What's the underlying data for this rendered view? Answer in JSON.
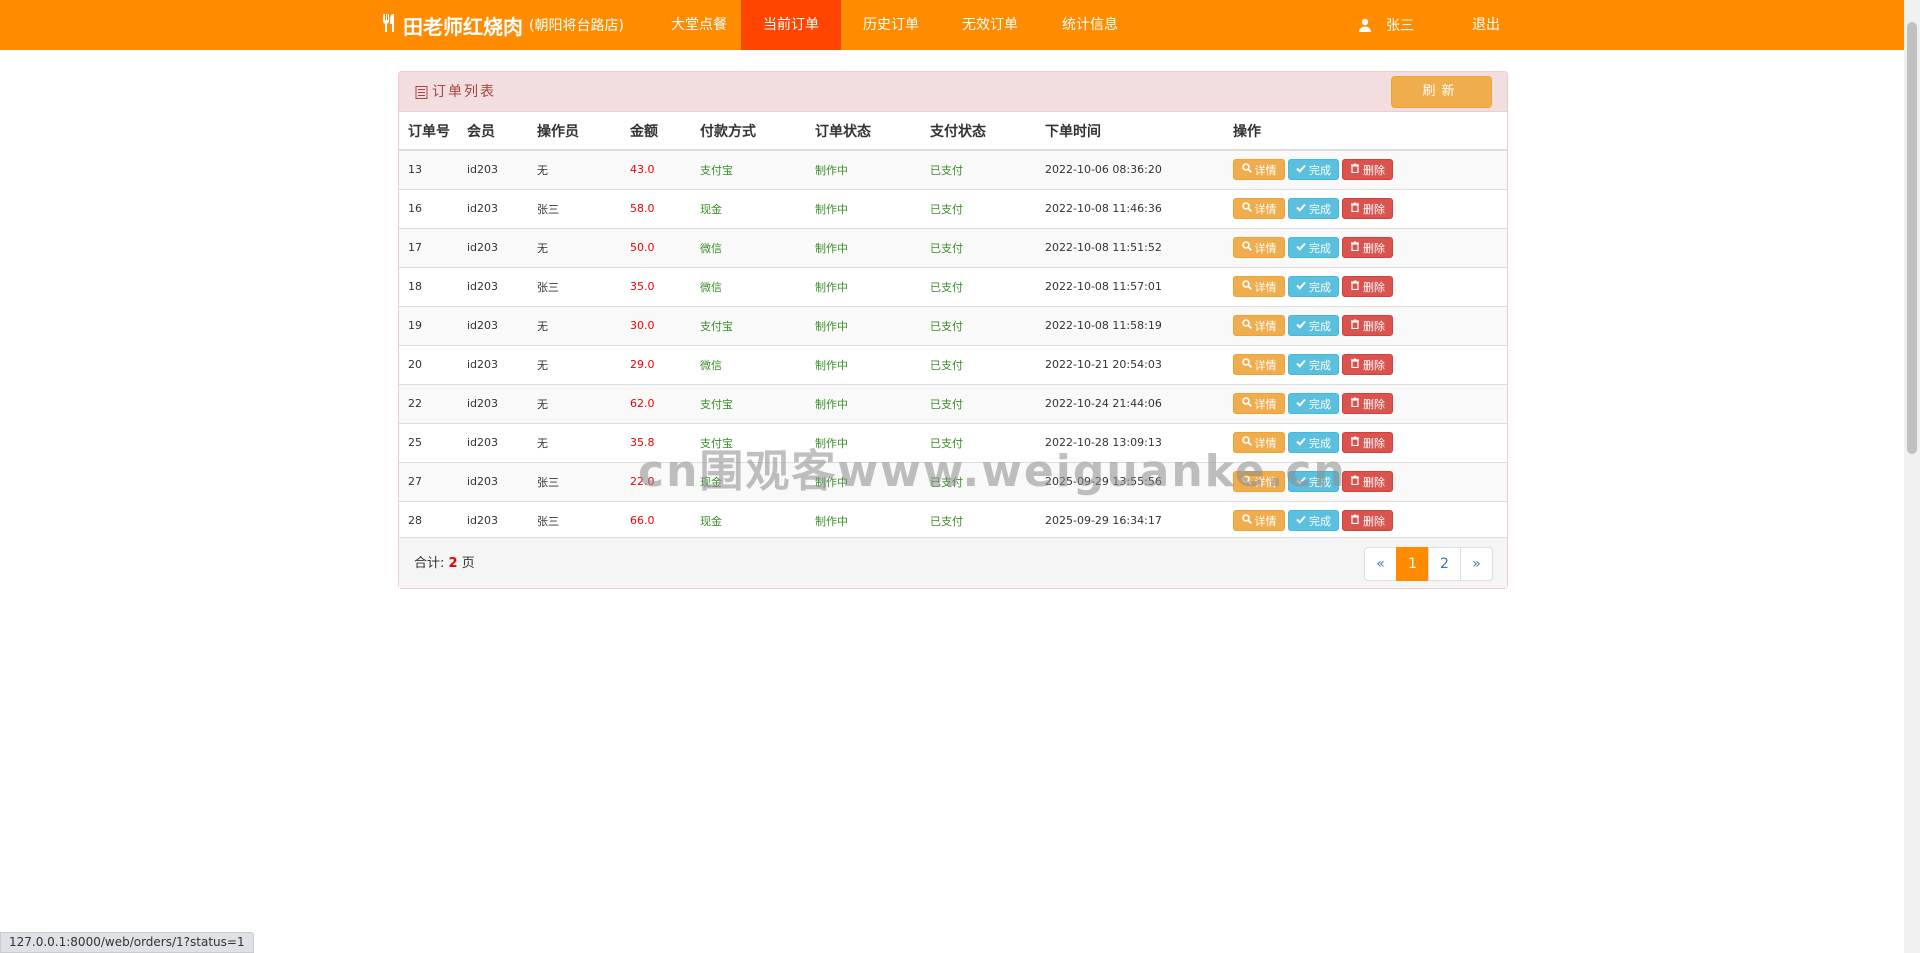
{
  "navbar": {
    "brand_name": "田老师红烧肉",
    "brand_sub": "(朝阳将台路店)",
    "items": [
      {
        "label": "大堂点餐"
      },
      {
        "label": "当前订单"
      },
      {
        "label": "历史订单"
      },
      {
        "label": "无效订单"
      },
      {
        "label": "统计信息"
      }
    ],
    "active_item": "当前订单",
    "user_name": "张三",
    "logout_label": "退出"
  },
  "panel": {
    "title": "订单列表",
    "refresh_label": "刷新",
    "columns": [
      "订单号",
      "会员",
      "操作员",
      "金额",
      "付款方式",
      "订单状态",
      "支付状态",
      "下单时间",
      "操作"
    ],
    "rows": [
      [
        "13",
        "id203",
        "无",
        "43.0",
        "支付宝",
        "制作中",
        "已支付",
        "2022-10-06 08:36:20"
      ],
      [
        "16",
        "id203",
        "张三",
        "58.0",
        "现金",
        "制作中",
        "已支付",
        "2022-10-08 11:46:36"
      ],
      [
        "17",
        "id203",
        "无",
        "50.0",
        "微信",
        "制作中",
        "已支付",
        "2022-10-08 11:51:52"
      ],
      [
        "18",
        "id203",
        "张三",
        "35.0",
        "微信",
        "制作中",
        "已支付",
        "2022-10-08 11:57:01"
      ],
      [
        "19",
        "id203",
        "无",
        "30.0",
        "支付宝",
        "制作中",
        "已支付",
        "2022-10-08 11:58:19"
      ],
      [
        "20",
        "id203",
        "无",
        "29.0",
        "微信",
        "制作中",
        "已支付",
        "2022-10-21 20:54:03"
      ],
      [
        "22",
        "id203",
        "无",
        "62.0",
        "支付宝",
        "制作中",
        "已支付",
        "2022-10-24 21:44:06"
      ],
      [
        "25",
        "id203",
        "无",
        "35.8",
        "支付宝",
        "制作中",
        "已支付",
        "2022-10-28 13:09:13"
      ],
      [
        "27",
        "id203",
        "张三",
        "22.0",
        "现金",
        "制作中",
        "已支付",
        "2025-09-29 13:55:56"
      ],
      [
        "28",
        "id203",
        "张三",
        "66.0",
        "现金",
        "制作中",
        "已支付",
        "2025-09-29 16:34:17"
      ]
    ],
    "actions": {
      "detail": "详情",
      "done": "完成",
      "delete": "删除"
    },
    "footer": {
      "total_prefix": "合计:",
      "total_pages": "2",
      "total_suffix": "页"
    },
    "pagination": [
      "«",
      "1",
      "2",
      "»"
    ],
    "current_page": "1"
  },
  "watermark": "cn围观客www.weiguanke.cn",
  "statusbar_url": "127.0.0.1:8000/web/orders/1?status=1",
  "colors": {
    "navbar": "#ff8c00",
    "nav_active": "#ff4500",
    "amount": "#e00000",
    "status_green": "#3a8e2a"
  }
}
